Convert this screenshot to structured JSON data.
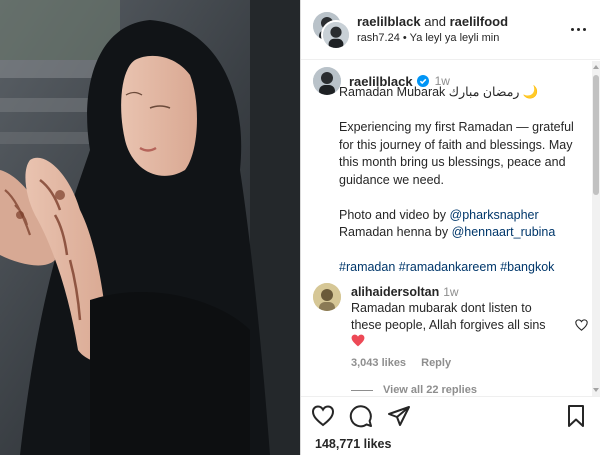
{
  "header": {
    "user1": "raelilblack",
    "connector": "and",
    "user2": "raelilfood",
    "audio_artist": "rash7.24",
    "audio_title": "Ya leyl ya leyli min"
  },
  "caption": {
    "username": "raelilblack",
    "time": "1w",
    "line1": "Ramadan Mubarak رمضان مبارك 🌙",
    "para1": "Experiencing my first Ramadan — grateful for this journey of faith and blessings. May this month bring us blessings, peace and guidance we need.",
    "photo_label": "Photo and video by ",
    "photo_mention": "@pharksnapher",
    "henna_label": "Ramadan henna by ",
    "henna_mention": "@hennaart_rubina",
    "hashtags": "#ramadan #ramadankareem #bangkok"
  },
  "comment": {
    "username": "alihaidersoltan",
    "time": "1w",
    "text": "Ramadan mubarak dont listen to these people, Allah forgives all sins",
    "likes": "3,043 likes",
    "reply": "Reply",
    "view_replies": "View all 22 replies"
  },
  "likes_count": "148,771 likes",
  "colors": {
    "link": "#00376b",
    "verified": "#0095f6",
    "heart": "#ed4956",
    "muted": "#8e8e8e"
  },
  "icons": [
    "more-icon",
    "verified-badge-icon",
    "heart-icon",
    "comment-icon",
    "share-icon",
    "bookmark-icon"
  ]
}
